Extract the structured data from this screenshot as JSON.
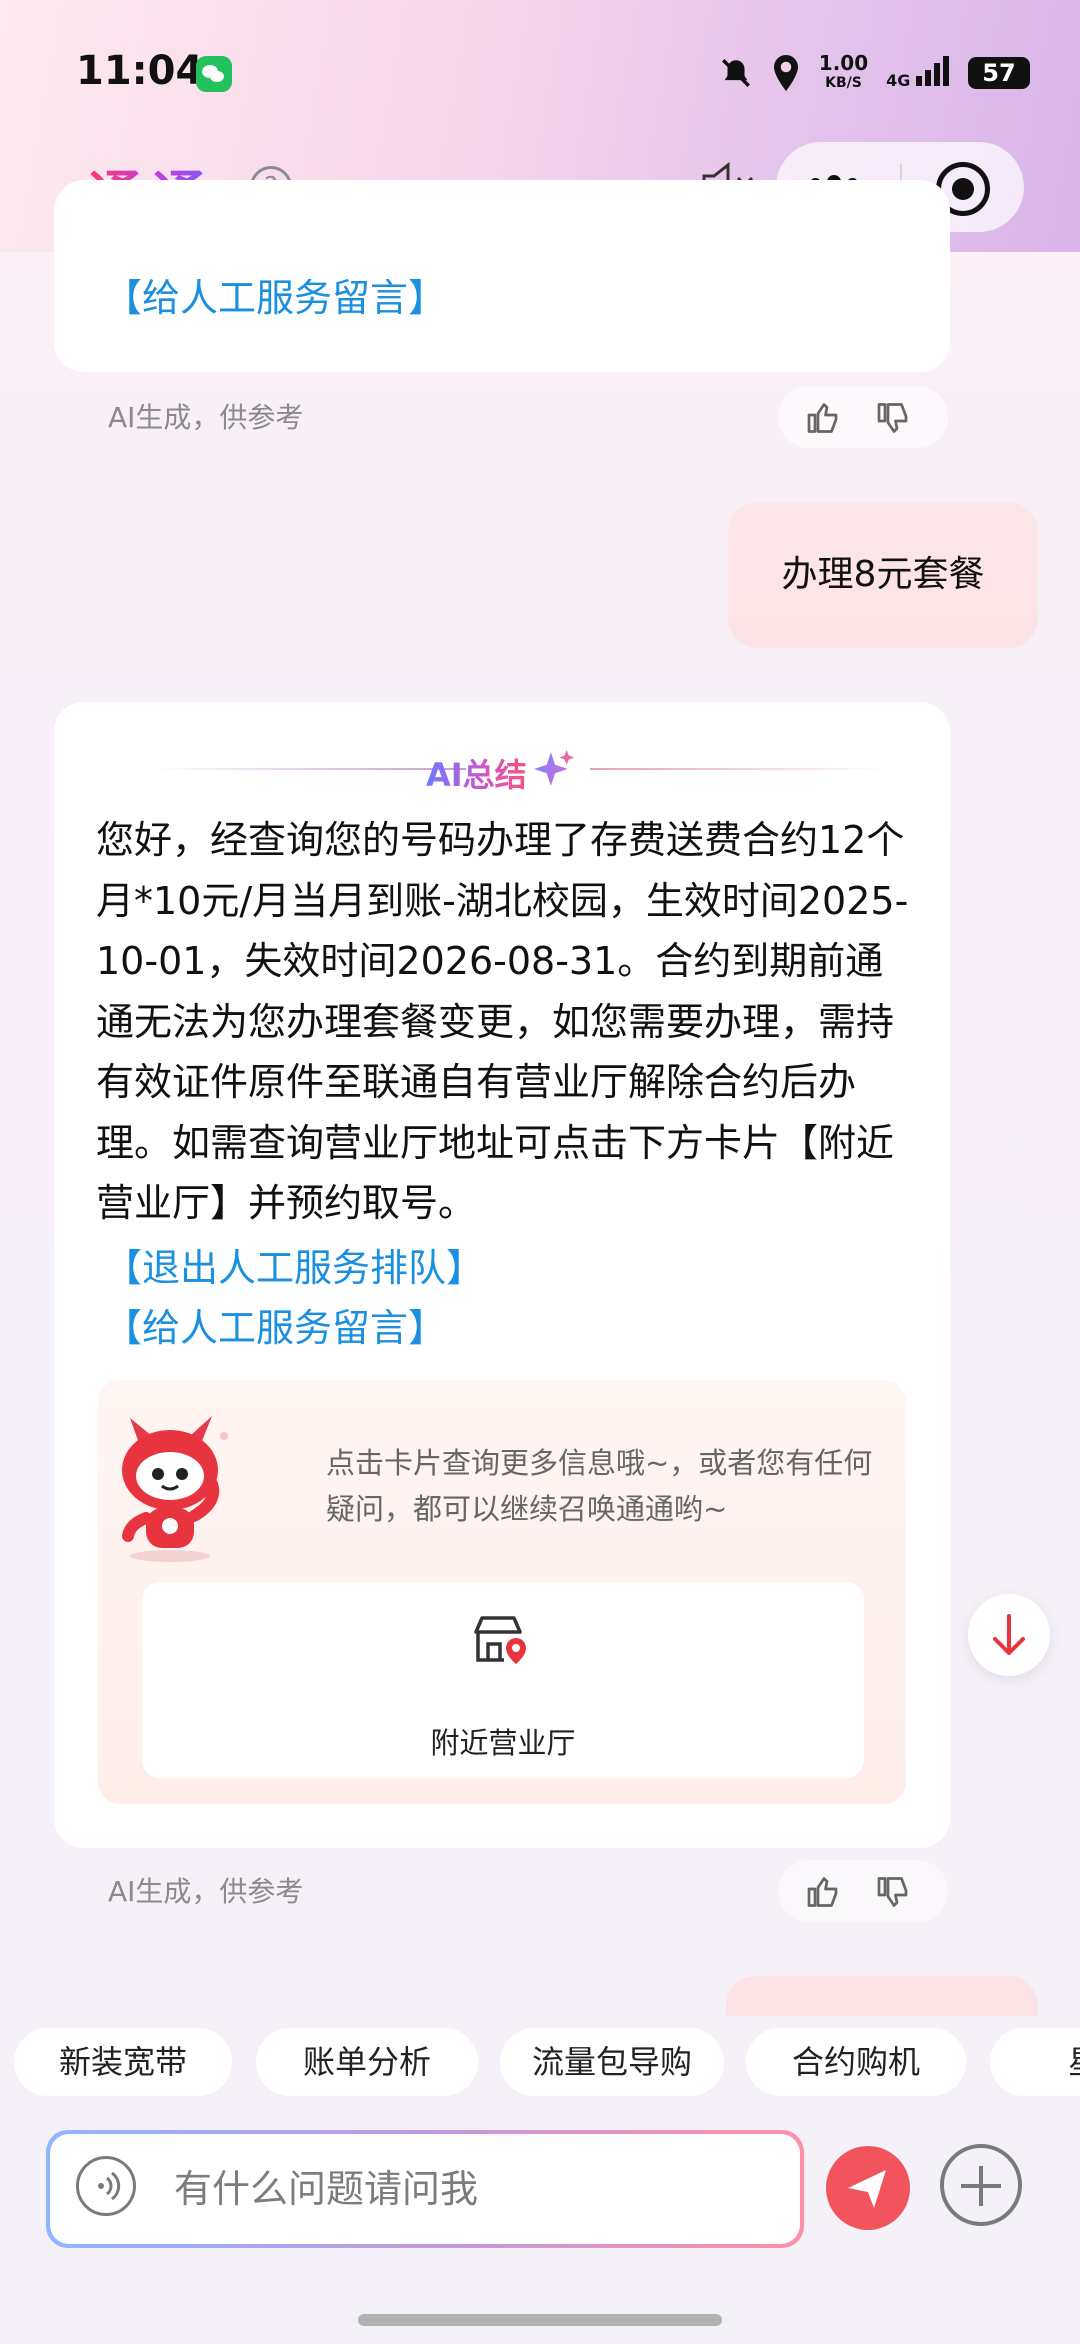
{
  "status_bar": {
    "time": "11:04",
    "net_speed": "1.00",
    "net_unit": "KB/S",
    "network": "4G",
    "battery": "57"
  },
  "header": {
    "brand": "通通",
    "help": "?"
  },
  "messages": {
    "prev_link_2": "【给人工服务留言】",
    "ai_note": "AI生成，供参考",
    "user_msg": "办理8元套餐",
    "summary_title": "AI总结",
    "summary_text": "您好，经查询您的号码办理了存费送费合约12个月*10元/月当月到账-湖北校园，生效时间2025-10-01，失效时间2026-08-31。合约到期前通通无法为您办理套餐变更，如您需要办理，需持有效证件原件至联通自有营业厅解除合约后办理。如需查询营业厅地址可点击下方卡片【附近营业厅】并预约取号。",
    "link_exit_queue": "【退出人工服务排队】",
    "link_leave_msg": "【给人工服务留言】",
    "card_hint": "点击卡片查询更多信息哦~，或者您有任何疑问，都可以继续召唤通通哟~",
    "store_label": "附近营业厅"
  },
  "quick_chips": [
    "新装宽带",
    "账单分析",
    "流量包导购",
    "合约购机",
    "星"
  ],
  "input": {
    "placeholder": "有什么问题请问我"
  },
  "colors": {
    "accent_red": "#f2545d",
    "link_blue": "#1b8fe0"
  }
}
